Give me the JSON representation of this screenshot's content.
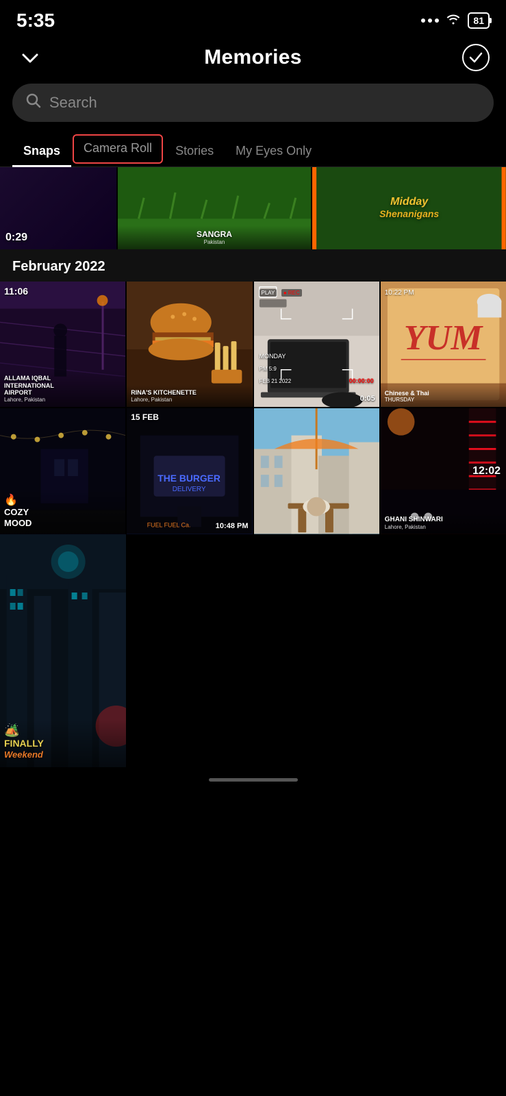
{
  "statusBar": {
    "time": "5:35",
    "battery": "81"
  },
  "header": {
    "title": "Memories",
    "chevronIcon": "chevron-down",
    "checkIcon": "checkmark"
  },
  "search": {
    "placeholder": "Search"
  },
  "tabs": [
    {
      "id": "snaps",
      "label": "Snaps",
      "active": true,
      "outlined": false
    },
    {
      "id": "camera-roll",
      "label": "Camera Roll",
      "active": false,
      "outlined": true
    },
    {
      "id": "stories",
      "label": "Stories",
      "active": false,
      "outlined": false
    },
    {
      "id": "my-eyes-only",
      "label": "My Eyes Only",
      "active": false,
      "outlined": false
    }
  ],
  "topRow": {
    "timeBadge": "0:29",
    "cards": [
      {
        "id": "sangra-card",
        "label": "SANGRA",
        "sublabel": "Pakistan"
      },
      {
        "id": "midday-card",
        "label": "Midday Shenanigans"
      }
    ]
  },
  "sections": [
    {
      "id": "feb-2022",
      "title": "February 2022",
      "cells": [
        {
          "id": "cell-1",
          "label": "ALLAMA IQBAL\nINTERNATIONAL\nAIRPORT",
          "sublabel": "Lahore, Pakistan",
          "timeBadge": "11:06",
          "fill": "fill-purple"
        },
        {
          "id": "cell-2",
          "label": "RINA'S KITCHENETTE",
          "sublabel": "Lahore, Pakistan",
          "fill": "fill-brown"
        },
        {
          "id": "cell-3",
          "timeBadge": "0:05",
          "dateBadge": "",
          "fill": "fill-gray",
          "hasRecOverlay": true
        },
        {
          "id": "cell-4",
          "label": "YUM\nChinese & Thai",
          "sublabel": "THURSDAY",
          "fill": "fill-warm"
        },
        {
          "id": "cell-5",
          "label": "COZY\nMOOD",
          "hasFlame": true,
          "fill": "fill-night"
        },
        {
          "id": "cell-6",
          "timeBadge": "10:48 PM",
          "dateBadge": "15 FEB",
          "fill": "fill-blue-dark"
        },
        {
          "id": "cell-7",
          "fill": "fill-teal"
        },
        {
          "id": "cell-8",
          "label": "GHANI SHINWARI",
          "sublabel": "Lahore, Pakistan",
          "timeBadge": "12:02",
          "fill": "fill-red-dark"
        }
      ]
    }
  ],
  "bottomRow": {
    "cells": [
      {
        "id": "bottom-1",
        "label": "FINALLY\nWeekend",
        "fill": "fill-cyan"
      }
    ]
  },
  "homeIndicator": {}
}
